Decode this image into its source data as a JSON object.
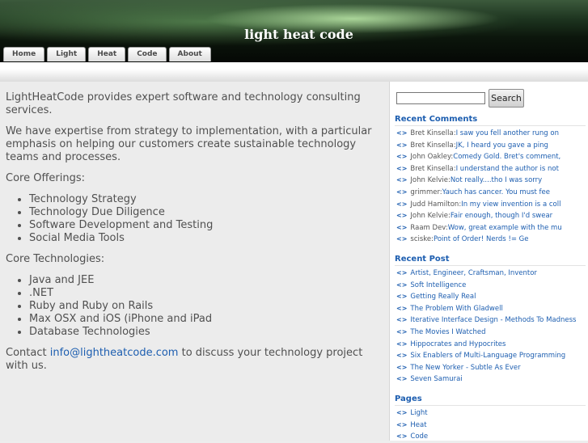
{
  "site": {
    "title": "light heat code"
  },
  "nav": {
    "tabs": [
      "Home",
      "Light",
      "Heat",
      "Code",
      "About"
    ]
  },
  "content": {
    "intro": "LightHeatCode provides expert software and technology consulting services.",
    "expertise": "We have expertise from strategy to implementation, with a particular emphasis on helping our customers create sustainable technology teams and processes.",
    "offerings_heading": "Core Offerings:",
    "offerings": [
      "Technology Strategy",
      "Technology Due Diligence",
      "Software Development and Testing",
      "Social Media Tools"
    ],
    "technologies_heading": "Core Technologies:",
    "technologies": [
      "Java and JEE",
      ".NET",
      "Ruby and Ruby on Rails",
      "Max OSX and iOS (iPhone and iPad",
      "Database Technologies"
    ],
    "contact_prefix": "Contact ",
    "contact_email": "info@lightheatcode.com",
    "contact_suffix": " to discuss your technology project with us."
  },
  "sidebar": {
    "search": {
      "value": "",
      "button": "Search"
    },
    "bullet": "<>",
    "recent_comments_title": "Recent Comments",
    "recent_comments": [
      {
        "who": "Bret Kinsella:",
        "text": "I saw you fell another rung on"
      },
      {
        "who": "Bret Kinsella:",
        "text": "JK, I heard you gave a ping"
      },
      {
        "who": "John Oakley:",
        "text": "Comedy Gold. Bret's comment,"
      },
      {
        "who": "Bret Kinsella:",
        "text": "I understand the author is not"
      },
      {
        "who": "John Kelvie:",
        "text": "Not really....tho I was sorry"
      },
      {
        "who": "grimmer:",
        "text": "Yauch has cancer. You must fee"
      },
      {
        "who": "Judd Hamilton:",
        "text": "In my view invention is a coll"
      },
      {
        "who": "John Kelvie:",
        "text": "Fair enough, though I'd swear"
      },
      {
        "who": "Raam Dev:",
        "text": "Wow, great example with the mu"
      },
      {
        "who": "sciske:",
        "text": "Point of Order! Nerds != Ge"
      }
    ],
    "recent_posts_title": "Recent Post",
    "recent_posts": [
      "Artist, Engineer, Craftsman, Inventor",
      "Soft Intelligence",
      "Getting Really Real",
      "The Problem With Gladwell",
      "Iterative Interface Design - Methods To Madness",
      "The Movies I Watched",
      "Hippocrates and Hypocrites",
      "Six Enablers of Multi-Language Programming",
      "The New Yorker - Subtle As Ever",
      "Seven Samurai"
    ],
    "pages_title": "Pages",
    "pages": [
      "Light",
      "Heat",
      "Code"
    ]
  }
}
